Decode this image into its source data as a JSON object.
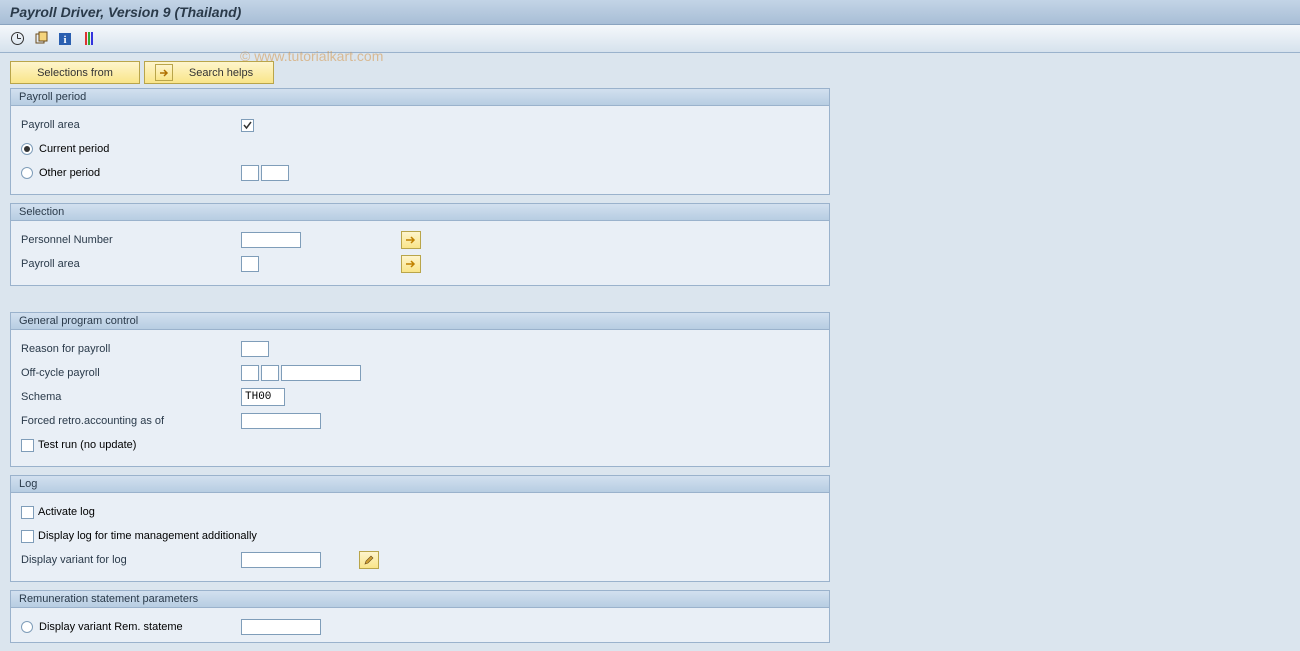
{
  "title": "Payroll Driver, Version 9 (Thailand)",
  "watermark": "© www.tutorialkart.com",
  "buttons": {
    "selections_from": "Selections from",
    "search_helps": "Search helps"
  },
  "groups": {
    "payroll_period": {
      "title": "Payroll period",
      "payroll_area_label": "Payroll area",
      "current_period": "Current period",
      "other_period": "Other period"
    },
    "selection": {
      "title": "Selection",
      "personnel_number": "Personnel Number",
      "payroll_area": "Payroll area"
    },
    "general": {
      "title": "General program control",
      "reason": "Reason for payroll",
      "offcycle": "Off-cycle payroll",
      "schema_label": "Schema",
      "schema_value": "TH00",
      "forced_retro": "Forced retro.accounting as of",
      "test_run": "Test run (no update)"
    },
    "log": {
      "title": "Log",
      "activate": "Activate log",
      "time_mgmt": "Display log for time management additionally",
      "display_variant": "Display variant for log"
    },
    "remuneration": {
      "title": "Remuneration statement parameters",
      "display_variant_rem": "Display variant Rem. stateme"
    }
  }
}
